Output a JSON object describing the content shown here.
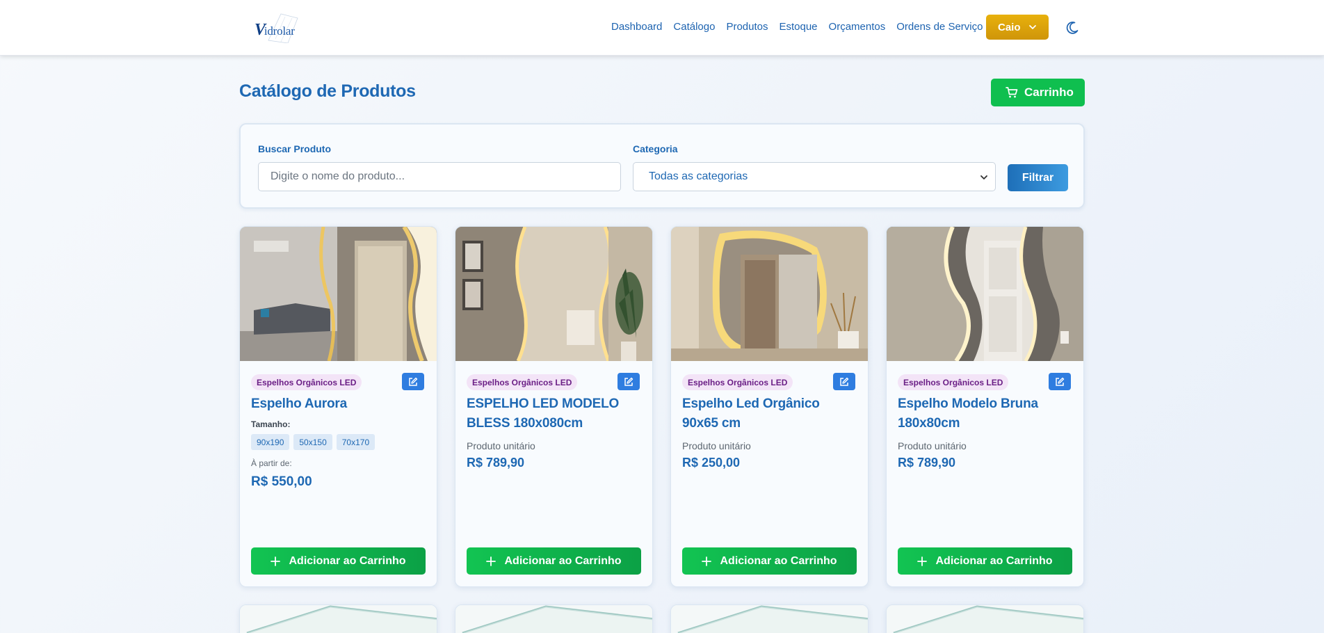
{
  "brand": {
    "name_initial": "V",
    "name_rest": "idrolar"
  },
  "nav": {
    "links": [
      "Dashboard",
      "Catálogo",
      "Produtos",
      "Estoque",
      "Orçamentos",
      "Ordens de Serviço"
    ],
    "user": "Caio",
    "user_icon": "chevron-down-icon",
    "theme_icon": "moon-icon"
  },
  "header": {
    "title": "Catálogo de Produtos",
    "cart_label": "Carrinho",
    "cart_icon": "cart-icon"
  },
  "filters": {
    "search_label": "Buscar Produto",
    "search_placeholder": "Digite o nome do produto...",
    "category_label": "Categoria",
    "category_value": "Todas as categorias",
    "filter_button": "Filtrar"
  },
  "products": [
    {
      "category": "Espelhos Orgânicos LED",
      "name": "Espelho Aurora",
      "size_label": "Tamanho:",
      "sizes": [
        "90x190",
        "50x150",
        "70x170"
      ],
      "from_label": "À partir de:",
      "price": "R$ 550,00",
      "add_label": "Adicionar ao Carrinho"
    },
    {
      "category": "Espelhos Orgânicos LED",
      "name": "ESPELHO LED MODELO BLESS 180x080cm",
      "unit_label": "Produto unitário",
      "price": "R$ 789,90",
      "add_label": "Adicionar ao Carrinho"
    },
    {
      "category": "Espelhos Orgânicos LED",
      "name": "Espelho Led Orgânico 90x65 cm",
      "unit_label": "Produto unitário",
      "price": "R$ 250,00",
      "add_label": "Adicionar ao Carrinho"
    },
    {
      "category": "Espelhos Orgânicos LED",
      "name": "Espelho Modelo Bruna 180x80cm",
      "unit_label": "Produto unitário",
      "price": "R$ 789,90",
      "add_label": "Adicionar ao Carrinho"
    }
  ],
  "colors": {
    "primary": "#1e68b3",
    "success": "#0fbf4f",
    "warning": "#e0a80c",
    "badge_bg": "#f3e4f7",
    "badge_text": "#6b1f86"
  }
}
